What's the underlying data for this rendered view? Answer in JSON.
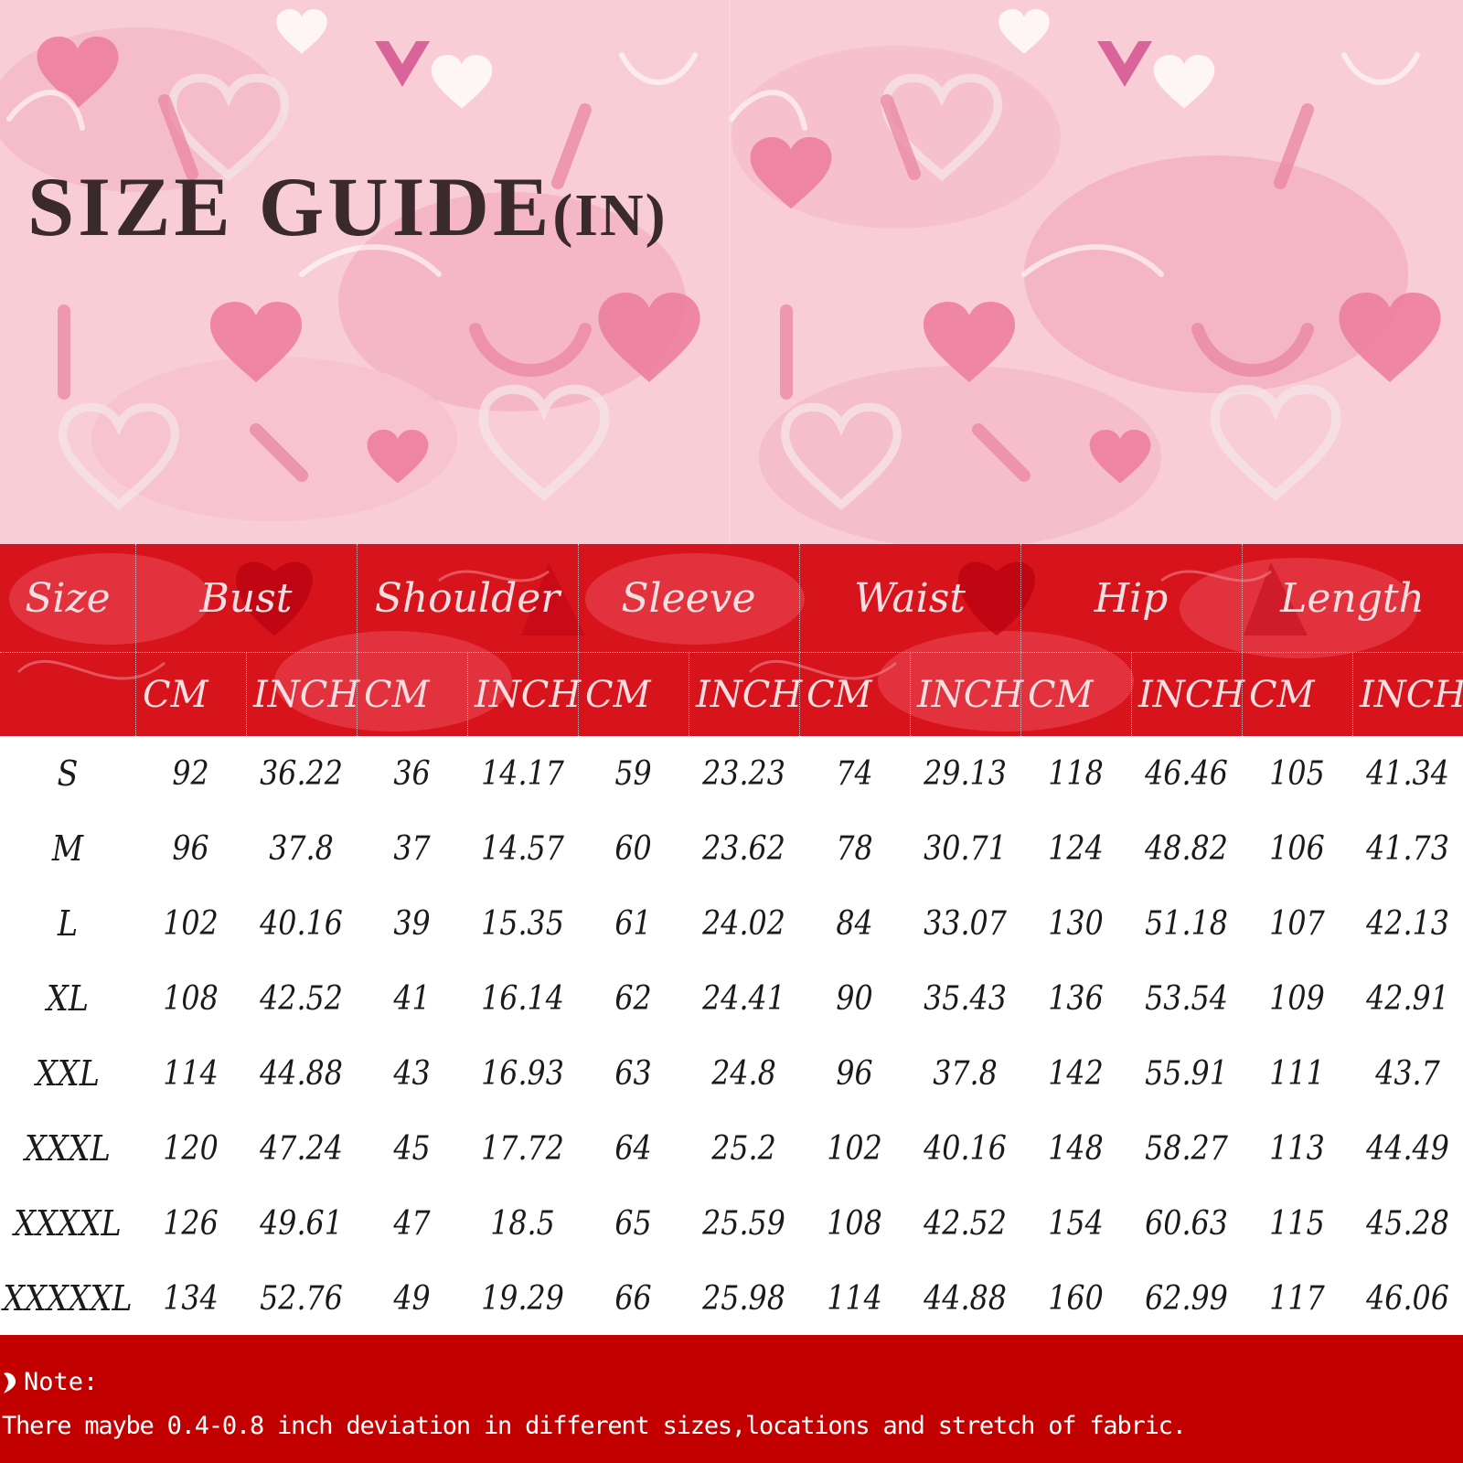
{
  "title": {
    "main": "SIZE GUIDE",
    "unit": "(IN)"
  },
  "header": {
    "size_label": "Size",
    "groups": [
      "Bust",
      "Shoulder",
      "Sleeve",
      "Waist",
      "Hip",
      "Length"
    ],
    "unit_cm": "CM",
    "unit_inch": "INCH"
  },
  "rows": [
    [
      "S",
      "92",
      "36.22",
      "36",
      "14.17",
      "59",
      "23.23",
      "74",
      "29.13",
      "118",
      "46.46",
      "105",
      "41.34"
    ],
    [
      "M",
      "96",
      "37.8",
      "37",
      "14.57",
      "60",
      "23.62",
      "78",
      "30.71",
      "124",
      "48.82",
      "106",
      "41.73"
    ],
    [
      "L",
      "102",
      "40.16",
      "39",
      "15.35",
      "61",
      "24.02",
      "84",
      "33.07",
      "130",
      "51.18",
      "107",
      "42.13"
    ],
    [
      "XL",
      "108",
      "42.52",
      "41",
      "16.14",
      "62",
      "24.41",
      "90",
      "35.43",
      "136",
      "53.54",
      "109",
      "42.91"
    ],
    [
      "XXL",
      "114",
      "44.88",
      "43",
      "16.93",
      "63",
      "24.8",
      "96",
      "37.8",
      "142",
      "55.91",
      "111",
      "43.7"
    ],
    [
      "XXXL",
      "120",
      "47.24",
      "45",
      "17.72",
      "64",
      "25.2",
      "102",
      "40.16",
      "148",
      "58.27",
      "113",
      "44.49"
    ],
    [
      "XXXXL",
      "126",
      "49.61",
      "47",
      "18.5",
      "65",
      "25.59",
      "108",
      "42.52",
      "154",
      "60.63",
      "115",
      "45.28"
    ],
    [
      "XXXXXL",
      "134",
      "52.76",
      "49",
      "19.29",
      "66",
      "25.98",
      "114",
      "44.88",
      "160",
      "62.99",
      "117",
      "46.06"
    ]
  ],
  "note": {
    "title": "Note:",
    "text": "There maybe 0.4-0.8 inch deviation in different sizes,locations and stretch of fabric."
  },
  "colors": {
    "banner_pink": "#f7c9d2",
    "header_red": "#d7141c",
    "note_red": "#c30000",
    "title_text": "#3a2a2e"
  }
}
